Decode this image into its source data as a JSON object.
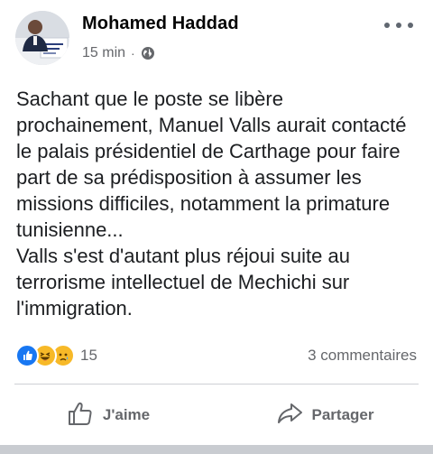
{
  "post": {
    "author": "Mohamed Haddad",
    "time": "15 min",
    "separator": "·",
    "privacy_icon": "globe-icon",
    "text": "Sachant que le poste se libère prochainement, Manuel Valls aurait contacté le palais présidentiel de Carthage pour faire part de sa prédisposition à assumer les missions difficiles, notamment la primature tunisienne...\nValls s'est d'autant plus réjoui suite au terrorisme intellectuel de Mechichi sur l'immigration.",
    "reactions": {
      "icons": [
        "like-reaction-icon",
        "haha-reaction-icon",
        "sad-reaction-icon"
      ],
      "count": "15"
    },
    "comments_label": "3 commentaires",
    "actions": {
      "like_label": "J'aime",
      "share_label": "Partager"
    }
  },
  "colors": {
    "like_blue": "#1877f2",
    "reaction_yellow": "#f7b928",
    "secondary_text": "#65676b",
    "divider": "#ced0d4"
  }
}
